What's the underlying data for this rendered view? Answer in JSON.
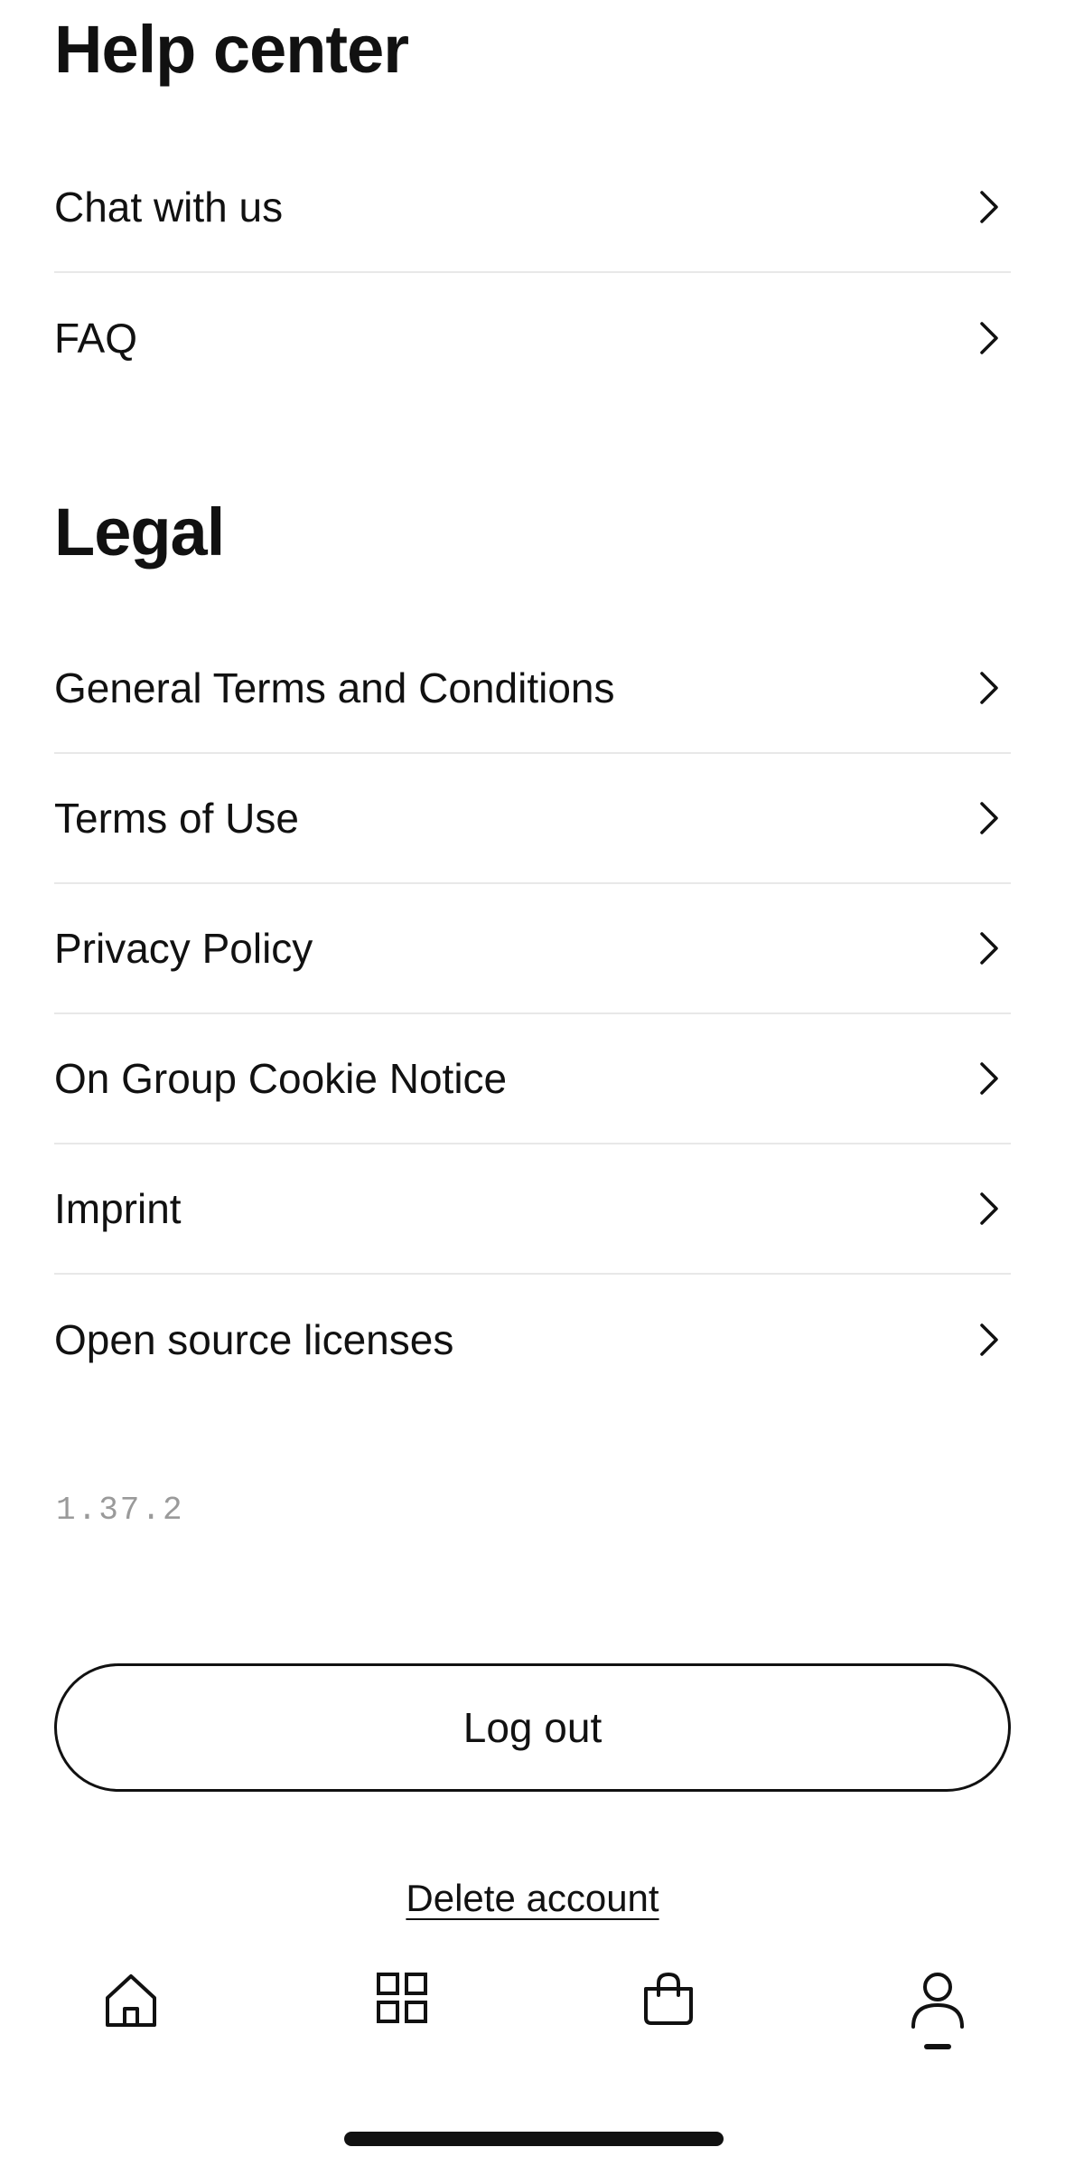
{
  "help_center": {
    "title": "Help center",
    "items": [
      {
        "label": "Chat with us"
      },
      {
        "label": "FAQ"
      }
    ]
  },
  "legal": {
    "title": "Legal",
    "items": [
      {
        "label": "General Terms and Conditions"
      },
      {
        "label": "Terms of Use"
      },
      {
        "label": "Privacy Policy"
      },
      {
        "label": "On Group Cookie Notice"
      },
      {
        "label": "Imprint"
      },
      {
        "label": "Open source licenses"
      }
    ]
  },
  "app_version": "1.37.2",
  "actions": {
    "logout_label": "Log out",
    "delete_account_label": "Delete account"
  },
  "tab_bar": {
    "tabs": [
      {
        "icon": "home-icon",
        "active": false
      },
      {
        "icon": "grid-icon",
        "active": false
      },
      {
        "icon": "shopping-bag-icon",
        "active": false
      },
      {
        "icon": "profile-icon",
        "active": true
      }
    ]
  },
  "colors": {
    "text": "#111111",
    "divider": "#e8e8e8",
    "version_text": "#9a9a9a",
    "background": "#ffffff"
  }
}
